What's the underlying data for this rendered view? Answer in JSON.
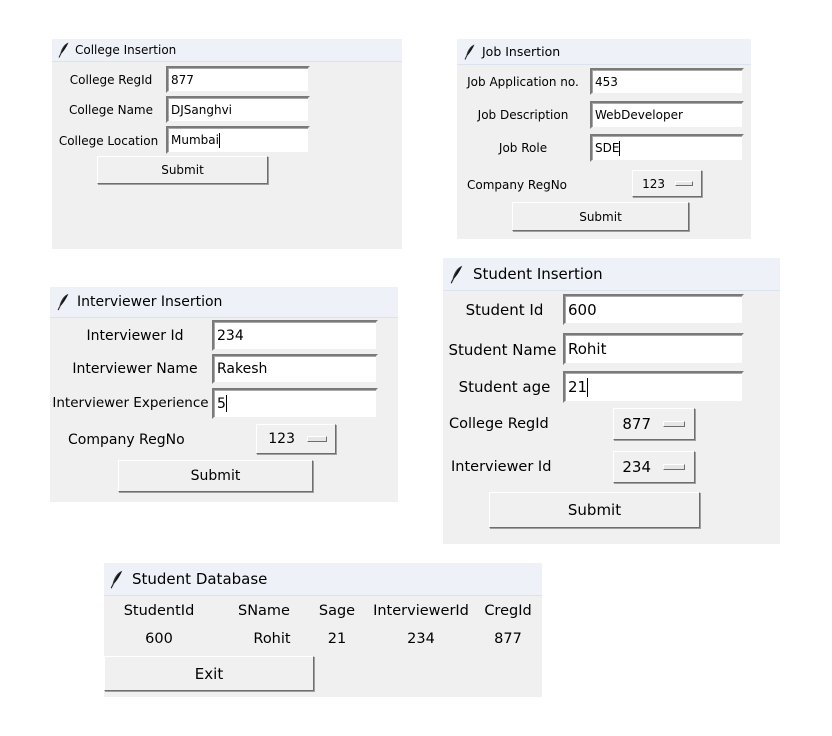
{
  "college": {
    "title": "College Insertion",
    "labels": [
      "College RegId",
      "College Name",
      "College Location"
    ],
    "values": [
      "877",
      "DJSanghvi",
      "Mumbai"
    ],
    "submit": "Submit"
  },
  "job": {
    "title": "Job Insertion",
    "labels": [
      "Job Application no.",
      "Job Description",
      "Job Role"
    ],
    "values": [
      "453",
      "WebDeveloper",
      "SDE"
    ],
    "company_label": "Company RegNo",
    "company_value": "123",
    "submit": "Submit"
  },
  "interviewer": {
    "title": "Interviewer Insertion",
    "labels": [
      "Interviewer Id",
      "Interviewer Name",
      "Interviewer Experience"
    ],
    "values": [
      "234",
      "Rakesh",
      "5"
    ],
    "company_label": "Company RegNo",
    "company_value": "123",
    "submit": "Submit"
  },
  "student": {
    "title": "Student Insertion",
    "labels": [
      "Student Id",
      "Student Name",
      "Student age"
    ],
    "values": [
      "600",
      "Rohit",
      "21"
    ],
    "college_label": "College RegId",
    "college_value": "877",
    "interviewer_label": "Interviewer Id",
    "interviewer_value": "234",
    "submit": "Submit"
  },
  "database": {
    "title": "Student Database",
    "columns": [
      "StudentId",
      "SName",
      "Sage",
      "InterviewerId",
      "CregId"
    ],
    "rows": [
      [
        "600",
        "Rohit",
        "21",
        "234",
        "877"
      ]
    ],
    "exit": "Exit"
  },
  "icon": "feather-icon"
}
